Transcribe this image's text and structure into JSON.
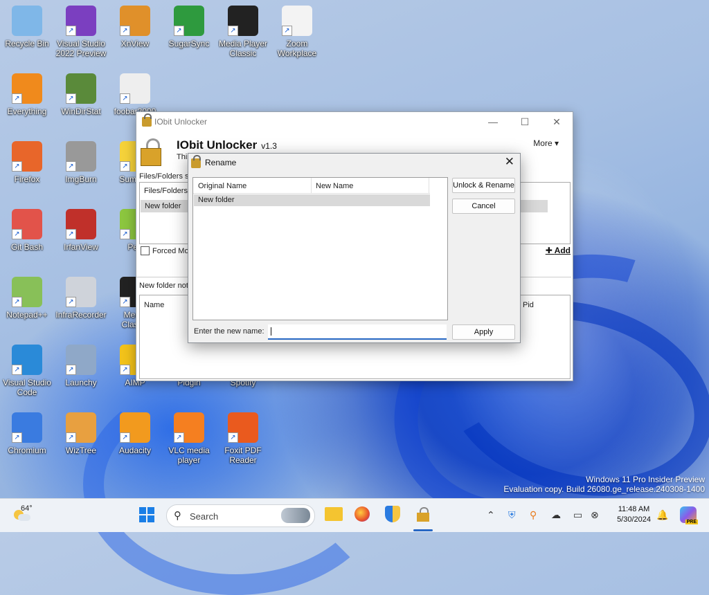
{
  "desktop": {
    "icons": [
      {
        "label": "Recycle Bin",
        "line2": "",
        "color": "#7fb7e8"
      },
      {
        "label": "Visual Studio",
        "line2": "2022 Preview",
        "color": "#7b3fc0"
      },
      {
        "label": "XnView",
        "line2": "",
        "color": "#e0902a"
      },
      {
        "label": "SugarSync",
        "line2": "",
        "color": "#2e9a3e"
      },
      {
        "label": "Media Player",
        "line2": "Classic",
        "color": "#222222"
      },
      {
        "label": "Zoom",
        "line2": "Workplace",
        "color": "#f3f3f3"
      },
      {
        "label": "Everything",
        "line2": "",
        "color": "#f08a1c"
      },
      {
        "label": "WinDirStat",
        "line2": "",
        "color": "#5a8a3a"
      },
      {
        "label": "Firefox",
        "line2": "",
        "color": "#e8662a"
      },
      {
        "label": "ImgBurn",
        "line2": "",
        "color": "#999999"
      },
      {
        "label": "Git Bash",
        "line2": "",
        "color": "#e2534a"
      },
      {
        "label": "IrfanView",
        "line2": "",
        "color": "#c0302a"
      },
      {
        "label": "Notepad++",
        "line2": "",
        "color": "#88c058"
      },
      {
        "label": "InfraRecorder",
        "line2": "",
        "color": "#cfd3da"
      },
      {
        "label": "Visual Studio",
        "line2": "Code",
        "color": "#2a8ad8"
      },
      {
        "label": "Launchy",
        "line2": "",
        "color": "#8fa8c8"
      },
      {
        "label": "Chromium",
        "line2": "",
        "color": "#3a7be0"
      },
      {
        "label": "WizTree",
        "line2": "",
        "color": "#e8a040"
      },
      {
        "label": "Audacity",
        "line2": "",
        "color": "#f29a1e"
      },
      {
        "label": "VLC media",
        "line2": "player",
        "color": "#f57f20"
      },
      {
        "label": "Foxit PDF",
        "line2": "Reader",
        "color": "#ea5a1e"
      },
      {
        "label": "foobar2000",
        "line2": "",
        "color": "#eeeeee"
      },
      {
        "label": "Sumatra",
        "line2": "",
        "color": "#f5d23a"
      },
      {
        "label": "Pea",
        "line2": "",
        "color": "#8cc63f"
      },
      {
        "label": "Media",
        "line2": "Classic",
        "color": "#222222"
      },
      {
        "label": "AIMP",
        "line2": "",
        "color": "#f2c21a"
      },
      {
        "label": "Pidgin",
        "line2": "",
        "color": "#8a6fb8"
      },
      {
        "label": "Spotify",
        "line2": "",
        "color": "#1db954"
      }
    ]
  },
  "main_window": {
    "title": "IObit Unlocker",
    "app_name": "IObit Unlocker",
    "version": "v1.3",
    "subtitle": "This",
    "more_label": "More ▾",
    "section_label": "Files/Folders se",
    "files_header": "Files/Folders",
    "files_row": "New folder",
    "forced_mode": "Forced Mod",
    "add_label": "Add",
    "status_text": "New folder not",
    "col_name": "Name",
    "col_pid": "Pid",
    "minimize": "—",
    "maximize": "☐",
    "close": "✕"
  },
  "rename_dialog": {
    "title": "Rename",
    "close": "✕",
    "col_original": "Original Name",
    "col_new": "New Name",
    "row_original": "New folder",
    "row_new": "",
    "unlock_rename_button": "Unlock & Rename",
    "cancel_button": "Cancel",
    "enter_label": "Enter the new name:",
    "entry_value": "",
    "apply_button": "Apply"
  },
  "taskbar": {
    "weather_temp": "64°",
    "search_placeholder": "Search",
    "time": "11:48 AM",
    "date": "5/30/2024",
    "badge_pre": "PRE"
  },
  "watermark": {
    "line1": "Windows 11 Pro Insider Preview",
    "line2": "Evaluation copy. Build 26080.ge_release.240308-1400"
  }
}
